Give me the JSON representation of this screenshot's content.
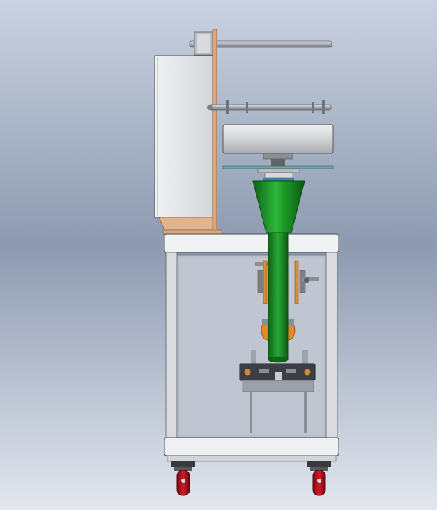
{
  "scene": {
    "subject": "vertical-form-fill-seal-packing-machine",
    "view": "side-elevation",
    "colors": {
      "background_top": "#c6d0df",
      "background_mid": "#8f9cb2",
      "background_bottom": "#e1e6ee",
      "housing": "#e9eaec",
      "frame": "#cfd2d6",
      "panel_glass": "#b9bfca",
      "funnel": "#1f9a2a",
      "funnel_dark": "#0e6b17",
      "tube": "#1a8a22",
      "hopper_drum": "#d8d8da",
      "dial_plate": "#6fa7a7",
      "bracket_wood": "#d9a77e",
      "bearing_orange": "#e08a2c",
      "caster_red": "#b0121b",
      "caster_body": "#3a3a3e",
      "steel": "#9ea3aa"
    },
    "parts": [
      "film-roll-axle",
      "film-guide-axle",
      "control-box",
      "film-bracket",
      "volumetric-cup-filler",
      "measuring-dial-plate",
      "forming-funnel",
      "forming-tube",
      "horizontal-seal-jaws",
      "machine-cabinet",
      "caster-wheel-left",
      "caster-wheel-right"
    ]
  }
}
